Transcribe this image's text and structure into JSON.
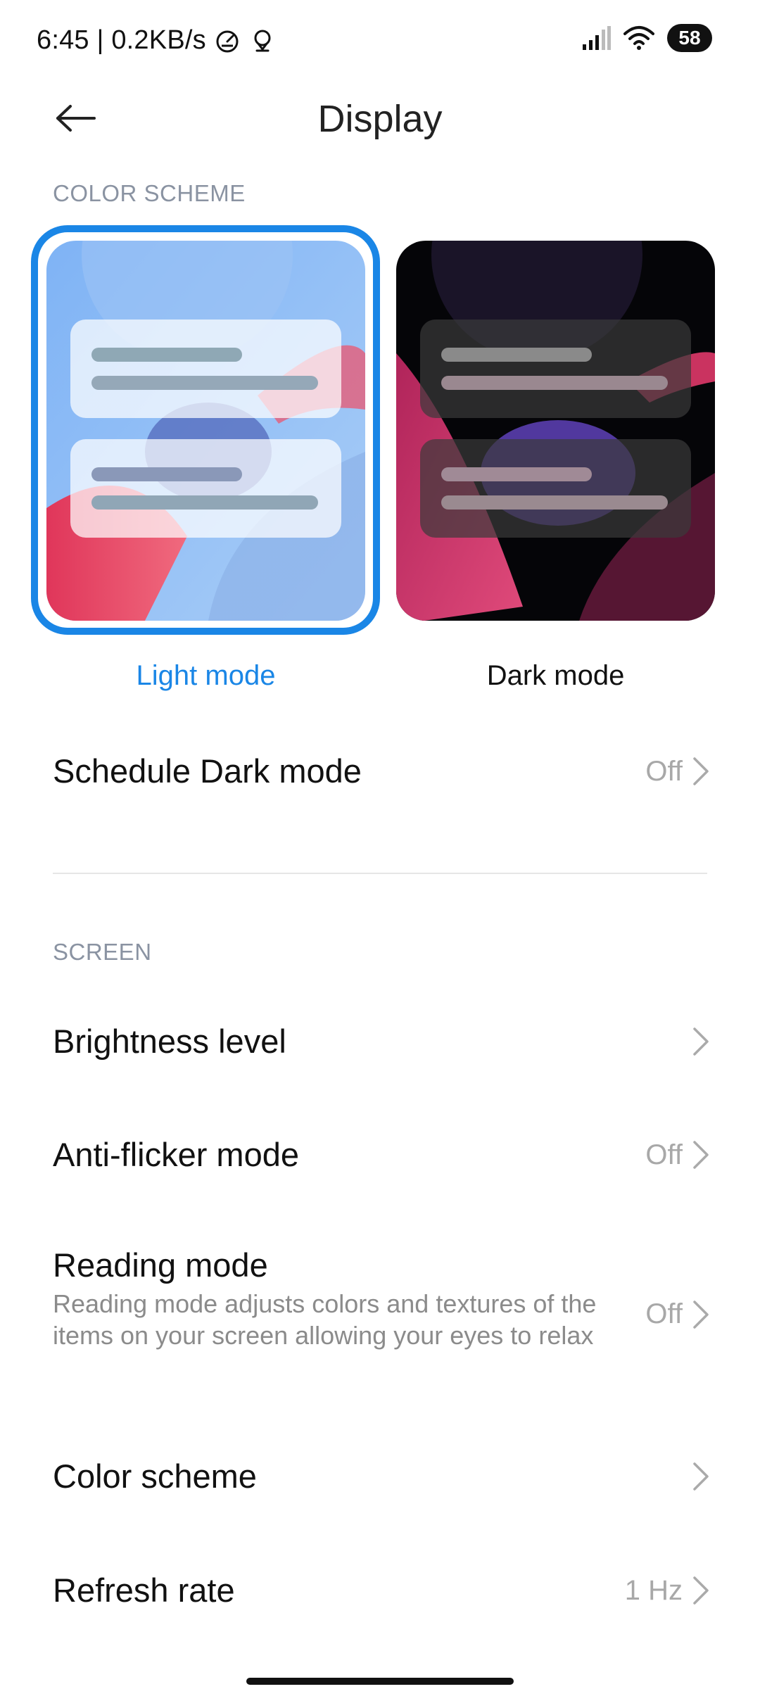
{
  "status_bar": {
    "time_speed": "6:45 | 0.2KB/s",
    "battery": "58",
    "icons": [
      "speedometer-icon",
      "location-icon",
      "signal-icon",
      "wifi-icon",
      "battery-icon"
    ]
  },
  "header": {
    "title": "Display",
    "back_icon": "arrow-left-icon"
  },
  "color_scheme_section": {
    "header": "COLOR SCHEME",
    "modes": [
      {
        "label": "Light mode",
        "selected": true
      },
      {
        "label": "Dark mode",
        "selected": false
      }
    ],
    "accent_color": "#1a86e6"
  },
  "schedule": {
    "title": "Schedule Dark mode",
    "value": "Off"
  },
  "screen_section": {
    "header": "SCREEN",
    "items": [
      {
        "title": "Brightness level",
        "value": ""
      },
      {
        "title": "Anti-flicker mode",
        "value": "Off"
      },
      {
        "title": "Reading mode",
        "subtitle": "Reading mode adjusts colors and textures of the items on your screen allowing your eyes to relax",
        "value": "Off"
      },
      {
        "title": "Color scheme",
        "value": ""
      },
      {
        "title": "Refresh rate",
        "value": "1 Hz"
      }
    ]
  }
}
